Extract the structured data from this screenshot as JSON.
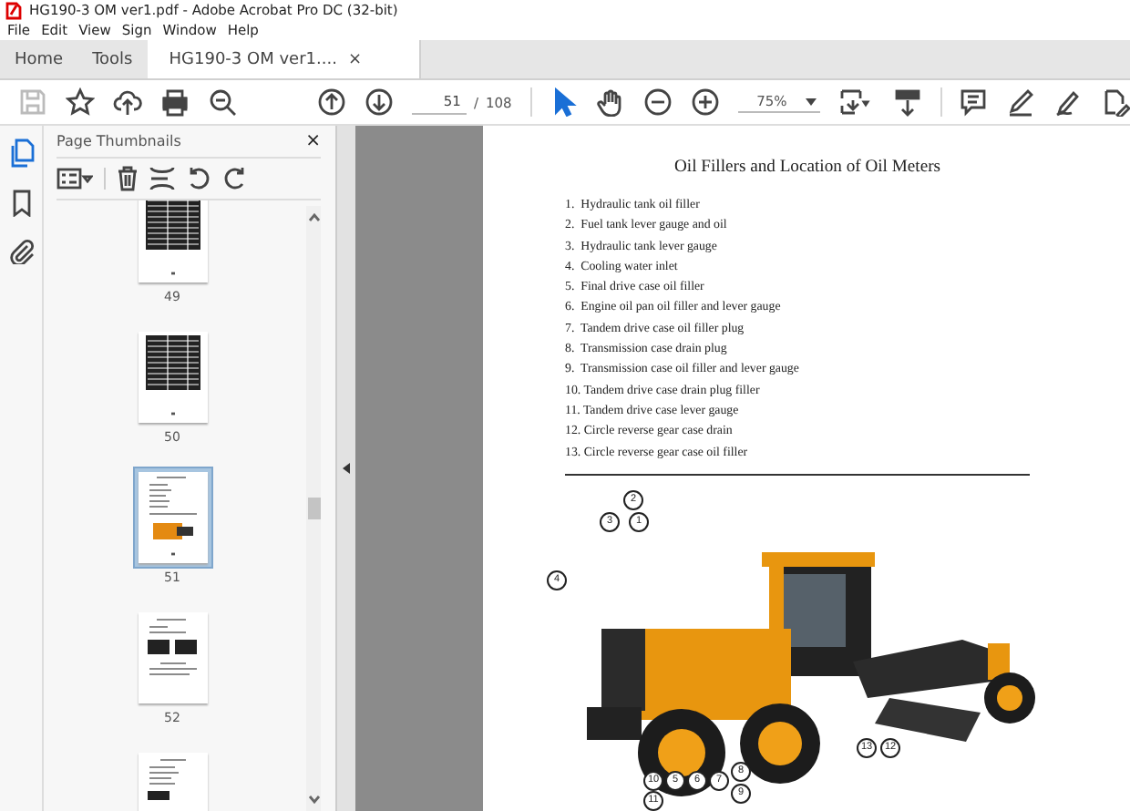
{
  "window": {
    "title": "HG190-3 OM ver1.pdf - Adobe Acrobat Pro DC (32-bit)"
  },
  "menu": [
    "File",
    "Edit",
    "View",
    "Sign",
    "Window",
    "Help"
  ],
  "tabs": [
    {
      "label": "Home",
      "selected": false
    },
    {
      "label": "Tools",
      "selected": false
    },
    {
      "label": "HG190-3 OM ver1....",
      "selected": true
    }
  ],
  "tab_close": "×",
  "toolbar": {
    "page_current": "51",
    "page_sep": "/",
    "page_total": "108",
    "zoom": "75%"
  },
  "panel": {
    "title": "Page Thumbnails",
    "close": "×",
    "thumbnails": [
      {
        "label": "49",
        "kind": "table",
        "selected": false
      },
      {
        "label": "50",
        "kind": "table",
        "selected": false
      },
      {
        "label": "51",
        "kind": "photo",
        "selected": true
      },
      {
        "label": "52",
        "kind": "images",
        "selected": false
      },
      {
        "kind": "text",
        "selected": false
      }
    ]
  },
  "document": {
    "title": "Oil Fillers and Location of Oil Meters",
    "items": [
      "1.  Hydraulic tank oil filler",
      "2.  Fuel tank lever gauge and oil",
      "3.  Hydraulic tank lever gauge",
      "4.  Cooling water inlet",
      "5.  Final drive case oil filler",
      "6.  Engine oil pan oil filler and lever gauge",
      "7.  Tandem drive case oil filler plug",
      "8.  Transmission case drain plug",
      "9.  Transmission case oil filler and lever gauge",
      "10. Tandem drive case drain plug filler",
      "11. Tandem drive case lever gauge",
      "12. Circle reverse gear case drain",
      "13. Circle reverse gear case oil filler"
    ],
    "callouts": [
      "2",
      "3",
      "1",
      "4",
      "10",
      "5",
      "6",
      "7",
      "8",
      "13",
      "12",
      "9",
      "11"
    ]
  }
}
